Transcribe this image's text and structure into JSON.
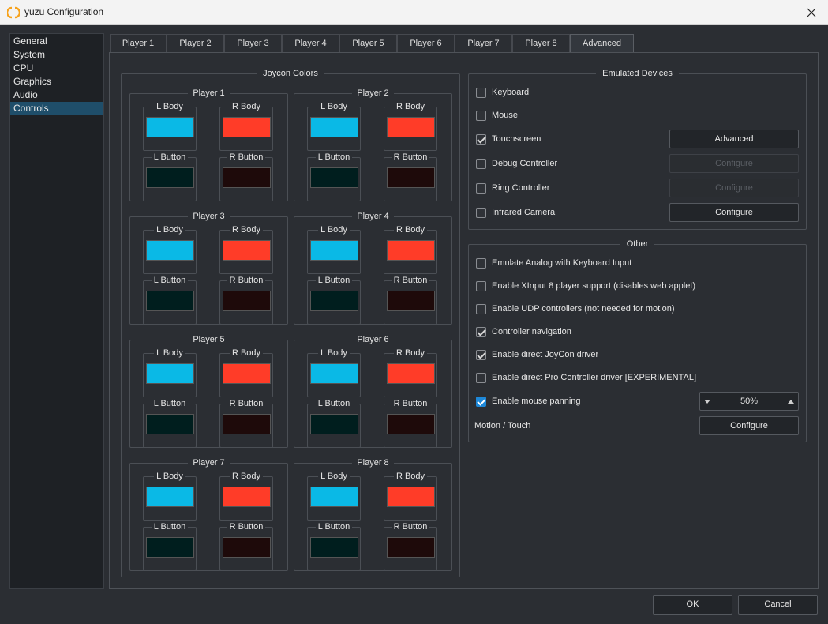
{
  "window": {
    "title": "yuzu Configuration"
  },
  "categories": [
    "General",
    "System",
    "CPU",
    "Graphics",
    "Audio",
    "Controls"
  ],
  "selected_category": "Controls",
  "tabs": [
    "Player 1",
    "Player 2",
    "Player 3",
    "Player 4",
    "Player 5",
    "Player 6",
    "Player 7",
    "Player 8",
    "Advanced"
  ],
  "active_tab": "Advanced",
  "joycon": {
    "title": "Joycon Colors",
    "l_body_label": "L Body",
    "r_body_label": "R Body",
    "l_button_label": "L Button",
    "r_button_label": "R Button",
    "players": [
      "Player 1",
      "Player 2",
      "Player 3",
      "Player 4",
      "Player 5",
      "Player 6",
      "Player 7",
      "Player 8"
    ],
    "colors": {
      "l_body": "#0ab9e6",
      "r_body": "#ff3c28",
      "l_button": "#001e1e",
      "r_button": "#1e0a0a"
    }
  },
  "emulated": {
    "title": "Emulated Devices",
    "keyboard": {
      "label": "Keyboard",
      "checked": false
    },
    "mouse": {
      "label": "Mouse",
      "checked": false
    },
    "touchscreen": {
      "label": "Touchscreen",
      "checked": true,
      "button": "Advanced"
    },
    "debug": {
      "label": "Debug Controller",
      "checked": false,
      "button": "Configure"
    },
    "ring": {
      "label": "Ring Controller",
      "checked": false,
      "button": "Configure"
    },
    "infrared": {
      "label": "Infrared Camera",
      "checked": false,
      "button": "Configure"
    }
  },
  "other": {
    "title": "Other",
    "emulate_analog": {
      "label": "Emulate Analog with Keyboard Input",
      "checked": false
    },
    "xinput": {
      "label": "Enable XInput 8 player support (disables web applet)",
      "checked": false
    },
    "udp": {
      "label": "Enable UDP controllers (not needed for motion)",
      "checked": false
    },
    "navigation": {
      "label": "Controller navigation",
      "checked": true
    },
    "joycon_driver": {
      "label": "Enable direct JoyCon driver",
      "checked": true
    },
    "pro_driver": {
      "label": "Enable direct Pro Controller driver [EXPERIMENTAL]",
      "checked": false
    },
    "mouse_panning": {
      "label": "Enable mouse panning",
      "checked": true,
      "value": "50%"
    },
    "motion": {
      "label": "Motion / Touch",
      "button": "Configure"
    }
  },
  "footer": {
    "ok": "OK",
    "cancel": "Cancel"
  }
}
